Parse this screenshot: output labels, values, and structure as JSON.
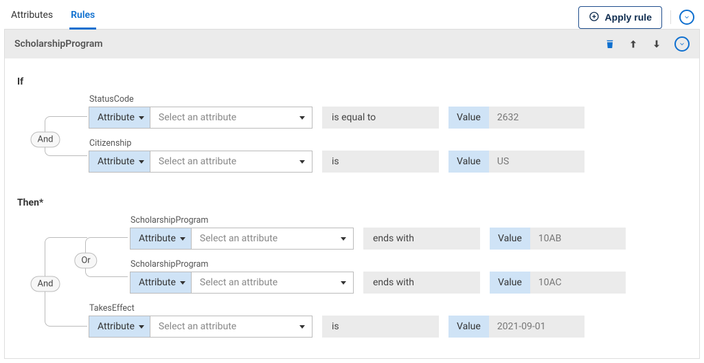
{
  "tabs": {
    "attributes": "Attributes",
    "rules": "Rules"
  },
  "apply_button": "Apply rule",
  "rule": {
    "title": "ScholarshipProgram"
  },
  "labels": {
    "if": "If",
    "then": "Then*",
    "attribute": "Attribute",
    "select_attr": "Select an attribute",
    "value": "Value",
    "op_and": "And",
    "op_or": "Or"
  },
  "if_block": {
    "operator": "and",
    "conditions": [
      {
        "label": "StatusCode",
        "comparator": "is equal to",
        "value": "2632"
      },
      {
        "label": "Citizenship",
        "comparator": "is",
        "value": "US"
      }
    ]
  },
  "then_block": {
    "operator": "and",
    "children": [
      {
        "operator": "or",
        "conditions": [
          {
            "label": "ScholarshipProgram",
            "comparator": "ends with",
            "value": "10AB"
          },
          {
            "label": "ScholarshipProgram",
            "comparator": "ends with",
            "value": "10AC"
          }
        ]
      },
      {
        "label": "TakesEffect",
        "comparator": "is",
        "value": "2021-09-01"
      }
    ]
  }
}
